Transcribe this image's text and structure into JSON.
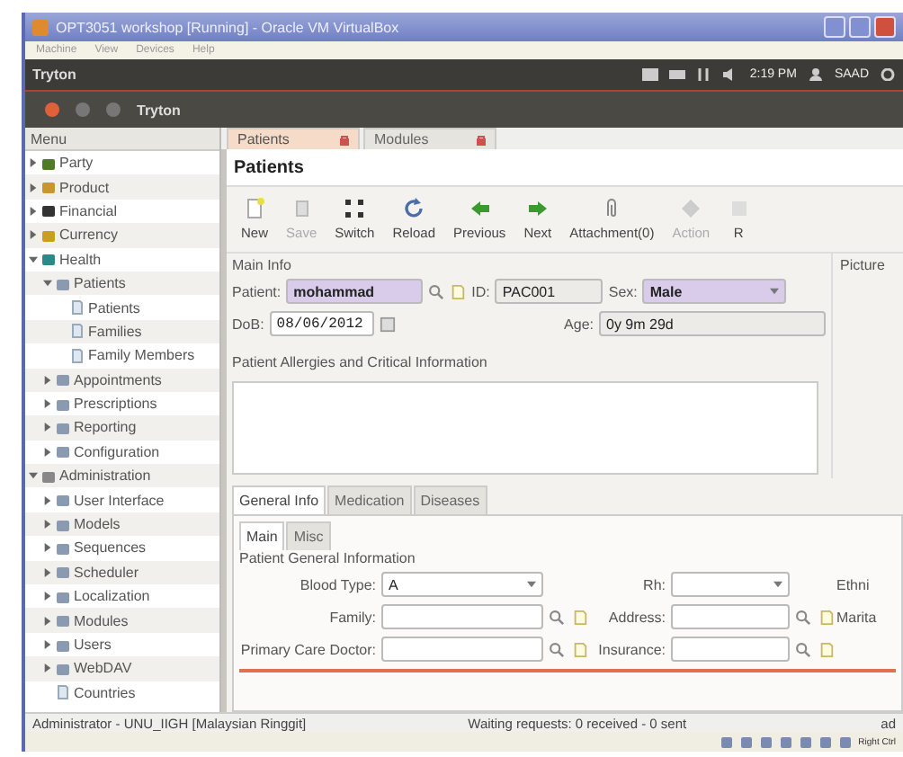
{
  "vbox": {
    "title": "OPT3051 workshop [Running] - Oracle VM VirtualBox",
    "menu": [
      "Machine",
      "View",
      "Devices",
      "Help"
    ],
    "host_key": "Right Ctrl"
  },
  "panel": {
    "app": "Tryton",
    "time": "2:19 PM",
    "user": "SAAD"
  },
  "window": {
    "title": "Tryton"
  },
  "sidebar": {
    "header": "Menu",
    "items": [
      {
        "label": "Party",
        "expanded": false,
        "selected": false
      },
      {
        "label": "Product",
        "expanded": false,
        "selected": false
      },
      {
        "label": "Financial",
        "expanded": false,
        "selected": false
      },
      {
        "label": "Currency",
        "expanded": false,
        "selected": false
      },
      {
        "label": "Health",
        "expanded": true,
        "selected": false,
        "children": [
          {
            "label": "Patients",
            "expanded": true,
            "selected": false,
            "children": [
              {
                "label": "Patients",
                "selected": false
              },
              {
                "label": "Families",
                "selected": false
              },
              {
                "label": "Family Members",
                "selected": false
              }
            ]
          },
          {
            "label": "Appointments",
            "expanded": false,
            "selected": false
          },
          {
            "label": "Prescriptions",
            "expanded": false,
            "selected": false
          },
          {
            "label": "Reporting",
            "expanded": false,
            "selected": false
          },
          {
            "label": "Configuration",
            "expanded": false,
            "selected": false
          }
        ]
      },
      {
        "label": "Administration",
        "expanded": true,
        "selected": false,
        "children": [
          {
            "label": "User Interface",
            "expanded": false,
            "selected": false
          },
          {
            "label": "Models",
            "expanded": false,
            "selected": false
          },
          {
            "label": "Sequences",
            "expanded": false,
            "selected": false
          },
          {
            "label": "Scheduler",
            "expanded": false,
            "selected": false
          },
          {
            "label": "Localization",
            "expanded": false,
            "selected": false
          },
          {
            "label": "Modules",
            "expanded": false,
            "selected": false
          },
          {
            "label": "Users",
            "expanded": false,
            "selected": false
          },
          {
            "label": "WebDAV",
            "expanded": false,
            "selected": false
          },
          {
            "label": "Countries",
            "selected": false
          }
        ]
      }
    ]
  },
  "tabs": [
    {
      "label": "Patients",
      "selected": true
    },
    {
      "label": "Modules",
      "selected": false
    }
  ],
  "form_title": "Patients",
  "toolbar": [
    {
      "label": "New",
      "disabled": false
    },
    {
      "label": "Save",
      "disabled": true
    },
    {
      "label": "Switch",
      "disabled": false
    },
    {
      "label": "Reload",
      "disabled": false
    },
    {
      "label": "Previous",
      "disabled": false
    },
    {
      "label": "Next",
      "disabled": false
    },
    {
      "label": "Attachment(0)",
      "disabled": false
    },
    {
      "label": "Action",
      "disabled": true
    },
    {
      "label": "R",
      "disabled": false
    }
  ],
  "main_info": {
    "legend": "Main Info",
    "patient": {
      "label": "Patient:",
      "value": "mohammad"
    },
    "id": {
      "label": "ID:",
      "value": "PAC001"
    },
    "sex": {
      "label": "Sex:",
      "value": "Male"
    },
    "dob": {
      "label": "DoB:",
      "value": "08/06/2012"
    },
    "age": {
      "label": "Age:",
      "value": "0y 9m 29d"
    },
    "allergies": {
      "label": "Patient Allergies and Critical Information"
    }
  },
  "picture": {
    "label": "Picture"
  },
  "notebook": {
    "tabs": [
      {
        "label": "General Info",
        "selected": true
      },
      {
        "label": "Medication",
        "selected": false
      },
      {
        "label": "Diseases",
        "selected": false
      }
    ],
    "subtabs": [
      {
        "label": "Main",
        "selected": true
      },
      {
        "label": "Misc",
        "selected": false
      }
    ],
    "legend": "Patient General Information",
    "rows": [
      [
        {
          "kind": "select",
          "label": "Blood Type:",
          "value": "A"
        },
        {
          "kind": "select",
          "label": "Rh:"
        },
        {
          "kind": "label",
          "label": "Ethni"
        }
      ],
      [
        {
          "kind": "reference",
          "label": "Family:"
        },
        {
          "kind": "reference",
          "label": "Address:"
        },
        {
          "kind": "label",
          "label": "Marita"
        }
      ],
      [
        {
          "kind": "reference",
          "label": "Primary Care Doctor:"
        },
        {
          "kind": "reference",
          "label": "Insurance:"
        }
      ]
    ]
  },
  "status": {
    "user": "Administrator - UNU_IIGH [Malaysian Ringgit]",
    "requests": "Waiting requests: 0 received - 0 sent",
    "right": "ad"
  }
}
